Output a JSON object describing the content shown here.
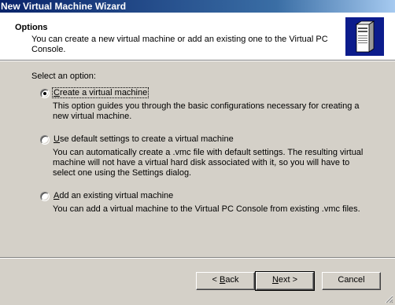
{
  "window": {
    "title": "New Virtual Machine Wizard"
  },
  "header": {
    "title": "Options",
    "description": "You can create a new virtual machine or add an existing one to the Virtual PC Console.",
    "icon": "computer-tower-icon"
  },
  "prompt": "Select an option:",
  "options": [
    {
      "label_pre": "",
      "label_key": "C",
      "label_post": "reate a virtual machine",
      "selected": true,
      "description": "This option guides you through the basic configurations necessary for creating a new virtual machine."
    },
    {
      "label_pre": "",
      "label_key": "U",
      "label_post": "se default settings to create a virtual machine",
      "selected": false,
      "description": "You can automatically create a .vmc file with default settings. The resulting virtual machine will not have a virtual hard disk associated with it, so you will have to select one using the Settings dialog."
    },
    {
      "label_pre": "",
      "label_key": "A",
      "label_post": "dd an existing virtual machine",
      "selected": false,
      "description": "You can add a virtual machine to the Virtual PC Console from existing .vmc files."
    }
  ],
  "buttons": {
    "back": {
      "pre": "< ",
      "key": "B",
      "post": "ack"
    },
    "next": {
      "pre": "",
      "key": "N",
      "post": "ext >"
    },
    "cancel": {
      "label": "Cancel"
    }
  }
}
